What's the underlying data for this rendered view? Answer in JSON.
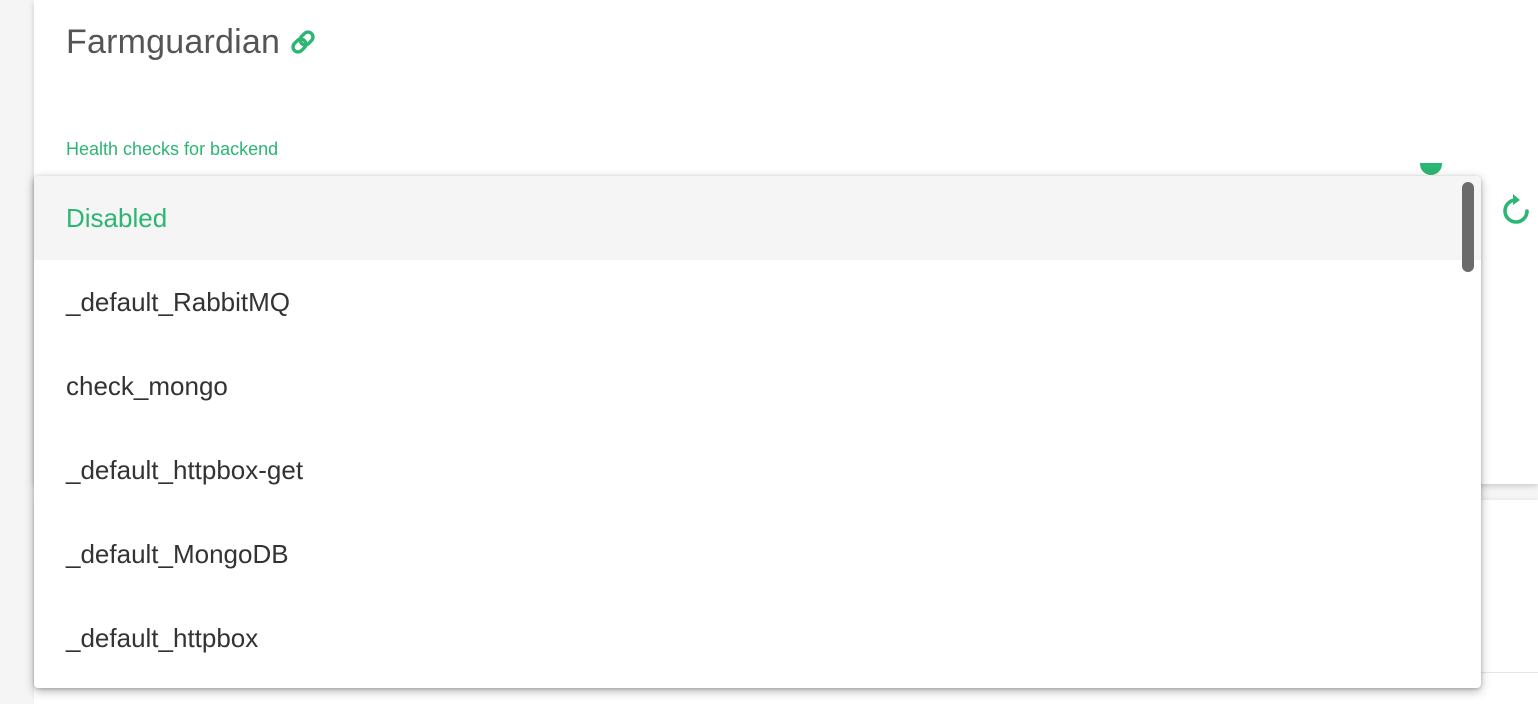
{
  "header": {
    "title": "Farmguardian",
    "link_icon": "link-icon"
  },
  "field": {
    "label": "Health checks for backend",
    "reload_icon": "reload-icon"
  },
  "dropdown": {
    "options": [
      {
        "label": "Disabled",
        "selected": true
      },
      {
        "label": "_default_RabbitMQ",
        "selected": false
      },
      {
        "label": "check_mongo",
        "selected": false
      },
      {
        "label": "_default_httpbox-get",
        "selected": false
      },
      {
        "label": "_default_MongoDB",
        "selected": false
      },
      {
        "label": "_default_httpbox",
        "selected": false
      }
    ]
  },
  "colors": {
    "accent": "#2bb673",
    "text": "#333333",
    "title": "#555555",
    "selected_bg": "#f5f5f5"
  }
}
